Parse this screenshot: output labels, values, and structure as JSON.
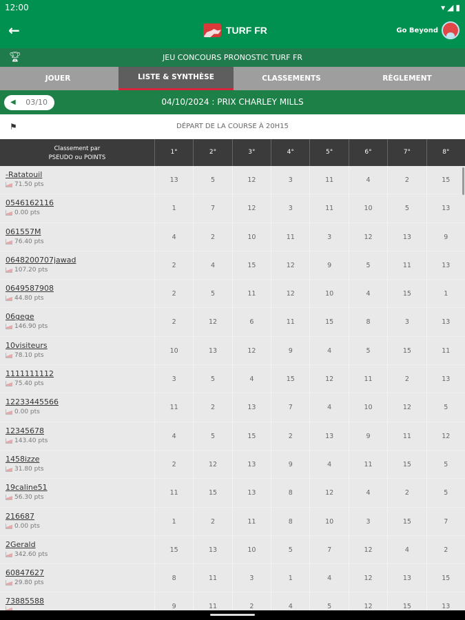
{
  "status": {
    "time": "12:00"
  },
  "appbar": {
    "title": "TURF FR",
    "user": "Go Beyond"
  },
  "banner": {
    "title": "JEU CONCOURS PRONOSTIC TURF FR"
  },
  "tabs": [
    {
      "label": "JOUER"
    },
    {
      "label": "LISTE & SYNTHÈSE"
    },
    {
      "label": "CLASSEMENTS"
    },
    {
      "label": "RÈGLEMENT"
    }
  ],
  "race": {
    "pager": "03/10",
    "title": "04/10/2024 : PRIX CHARLEY MILLS",
    "depart": "DÉPART DE LA COURSE À 20H15"
  },
  "table": {
    "header_line1": "Classement par",
    "header_line2": "PSEUDO ou POINTS",
    "columns": [
      "1°",
      "2°",
      "3°",
      "4°",
      "5°",
      "6°",
      "7°",
      "8°"
    ],
    "rows": [
      {
        "name": "-Ratatouil",
        "pts": "71.50 pts",
        "picks": [
          13,
          5,
          12,
          3,
          11,
          4,
          2,
          15
        ]
      },
      {
        "name": "0546162116",
        "pts": "0.00 pts",
        "picks": [
          1,
          7,
          12,
          3,
          11,
          10,
          5,
          13
        ]
      },
      {
        "name": "061557M",
        "pts": "76.40 pts",
        "picks": [
          4,
          2,
          10,
          11,
          3,
          12,
          13,
          9
        ]
      },
      {
        "name": "0648200707jawad",
        "pts": "107.20 pts",
        "picks": [
          2,
          4,
          15,
          12,
          9,
          5,
          11,
          13
        ]
      },
      {
        "name": "0649587908",
        "pts": "44.80 pts",
        "picks": [
          2,
          5,
          11,
          12,
          10,
          4,
          15,
          1
        ]
      },
      {
        "name": "06gege",
        "pts": "146.90 pts",
        "picks": [
          2,
          12,
          6,
          11,
          15,
          8,
          3,
          13
        ]
      },
      {
        "name": "10visiteurs",
        "pts": "78.10 pts",
        "picks": [
          10,
          13,
          12,
          9,
          4,
          5,
          15,
          11
        ]
      },
      {
        "name": "1111111112",
        "pts": "75.40 pts",
        "picks": [
          3,
          5,
          4,
          15,
          12,
          11,
          2,
          13
        ]
      },
      {
        "name": "12233445566",
        "pts": "0.00 pts",
        "picks": [
          11,
          2,
          13,
          7,
          4,
          10,
          12,
          5
        ]
      },
      {
        "name": "12345678",
        "pts": "143.40 pts",
        "picks": [
          4,
          5,
          15,
          2,
          13,
          9,
          11,
          12
        ]
      },
      {
        "name": "1458izze",
        "pts": "31.80 pts",
        "picks": [
          2,
          12,
          13,
          9,
          4,
          11,
          15,
          5
        ]
      },
      {
        "name": "19caline51",
        "pts": "56.30 pts",
        "picks": [
          11,
          15,
          13,
          8,
          12,
          4,
          2,
          5
        ]
      },
      {
        "name": "216687",
        "pts": "0.00 pts",
        "picks": [
          1,
          2,
          11,
          8,
          10,
          3,
          15,
          7
        ]
      },
      {
        "name": "2Gerald",
        "pts": "342.60 pts",
        "picks": [
          15,
          13,
          10,
          5,
          7,
          12,
          4,
          2
        ]
      },
      {
        "name": "60847627",
        "pts": "29.80 pts",
        "picks": [
          8,
          11,
          3,
          1,
          4,
          12,
          13,
          15
        ]
      },
      {
        "name": "73885588",
        "pts": "",
        "picks": [
          9,
          11,
          2,
          4,
          5,
          12,
          15,
          13
        ]
      }
    ]
  }
}
